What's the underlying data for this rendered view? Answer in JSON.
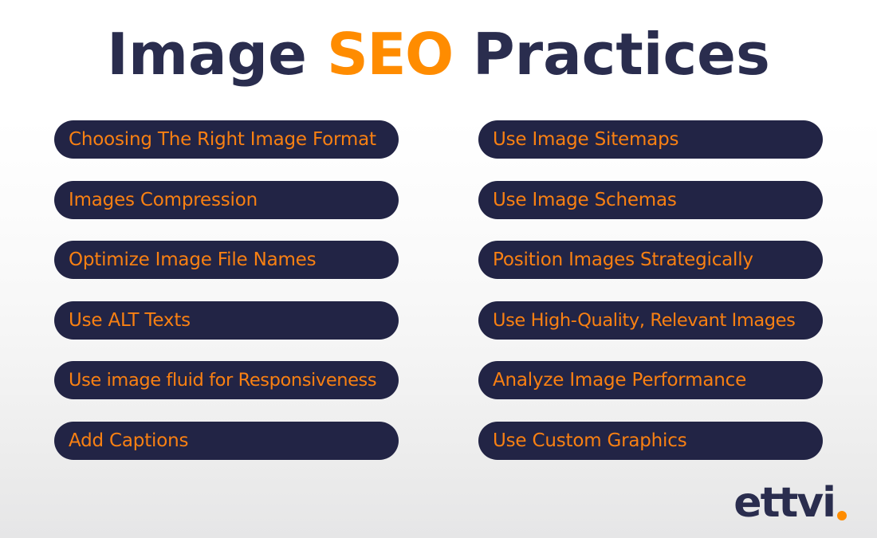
{
  "title": {
    "part1": "Image ",
    "highlight": "SEO",
    "part2": " Practices",
    "full": "Image SEO Practices"
  },
  "colors": {
    "pill_background": "#222445",
    "pill_text": "#f98012",
    "title_text": "#2a2d4e",
    "title_highlight": "#ff8c00",
    "logo_text": "#2a2d4e",
    "logo_dot": "#ff8c00",
    "page_background_top": "#ffffff",
    "page_background_bottom": "#e6e6e7"
  },
  "left_column": [
    {
      "label": "Choosing The Right Image Format"
    },
    {
      "label": "Images Compression"
    },
    {
      "label": "Optimize Image File Names"
    },
    {
      "label": "Use ALT Texts"
    },
    {
      "label": "Use image fluid for Responsiveness"
    },
    {
      "label": "Add Captions"
    }
  ],
  "right_column": [
    {
      "label": "Use Image Sitemaps"
    },
    {
      "label": "Use Image Schemas"
    },
    {
      "label": "Position Images Strategically"
    },
    {
      "label": "Use High-Quality, Relevant Images"
    },
    {
      "label": "Analyze Image Performance"
    },
    {
      "label": "Use Custom Graphics"
    }
  ],
  "logo": {
    "word": "ettvi",
    "dot": "."
  }
}
